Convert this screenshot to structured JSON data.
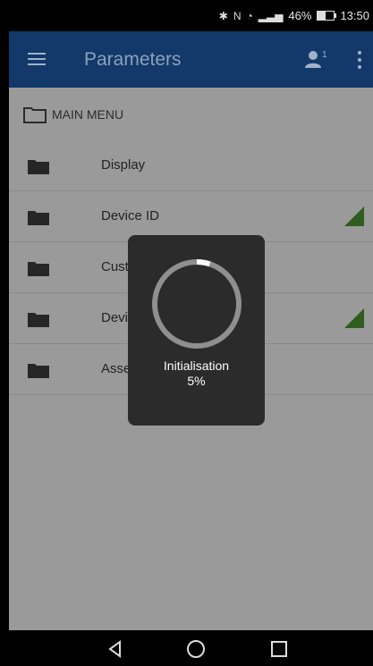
{
  "status_bar": {
    "battery": "46%",
    "time": "13:50",
    "battery_level": 0.46
  },
  "app_bar": {
    "title": "Parameters",
    "user_badge": "1"
  },
  "breadcrumb": {
    "label": "MAIN MENU"
  },
  "menu": {
    "items": [
      {
        "label": "Display"
      },
      {
        "label": "Device ID"
      },
      {
        "label": "Customer Settings"
      },
      {
        "label": "Device configuration"
      },
      {
        "label": "Asset Management"
      }
    ]
  },
  "loader": {
    "title": "Initialisation",
    "progress_text": "5%",
    "progress": 0.05
  },
  "colors": {
    "app_bar": "#12396a",
    "overlay": "#9a9a9a",
    "flag": "#2e5d1f"
  }
}
